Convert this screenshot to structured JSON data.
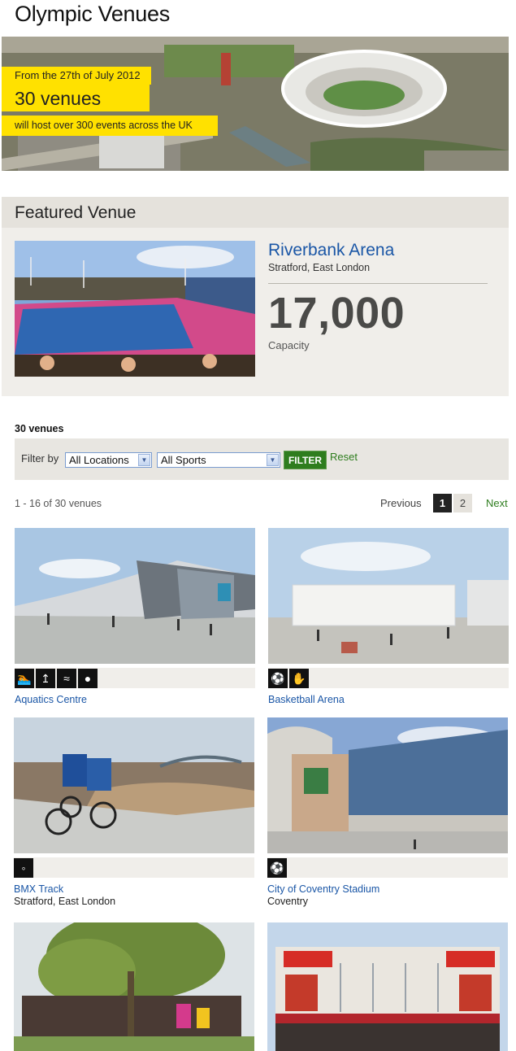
{
  "page": {
    "title": "Olympic Venues"
  },
  "hero": {
    "line1": "From the 27th of July 2012",
    "line2": "30 venues",
    "line3": "will host over 300 events across the UK",
    "accent": "#ffe100"
  },
  "featured": {
    "heading": "Featured Venue",
    "name": "Riverbank Arena",
    "location": "Stratford, East London",
    "capacity": "17,000",
    "capacity_label": "Capacity"
  },
  "listing": {
    "count": "30 venues",
    "filter_label": "Filter by",
    "location_select": "All Locations",
    "sport_select": "All Sports",
    "filter_button": "FILTER",
    "reset": "Reset",
    "range": "1 - 16 of 30 venues",
    "previous": "Previous",
    "pages": [
      "1",
      "2"
    ],
    "current_page": "1",
    "next": "Next"
  },
  "venues": [
    {
      "name": "Aquatics Centre",
      "location": "",
      "icons": [
        "swimming-icon",
        "diving-icon",
        "synchronised-swimming-icon",
        "water-polo-icon"
      ]
    },
    {
      "name": "Basketball Arena",
      "location": "",
      "icons": [
        "basketball-icon",
        "handball-icon"
      ]
    },
    {
      "name": "BMX Track",
      "location": "Stratford, East London",
      "icons": [
        "cycling-bmx-icon"
      ]
    },
    {
      "name": "City of Coventry Stadium",
      "location": "Coventry",
      "icons": [
        "football-icon"
      ]
    },
    {
      "name": "",
      "location": "",
      "icons": []
    },
    {
      "name": "",
      "location": "",
      "icons": []
    }
  ],
  "colors": {
    "link": "#1a56a6",
    "filter_button": "#2e7d1e",
    "panel": "#f0eeea"
  }
}
